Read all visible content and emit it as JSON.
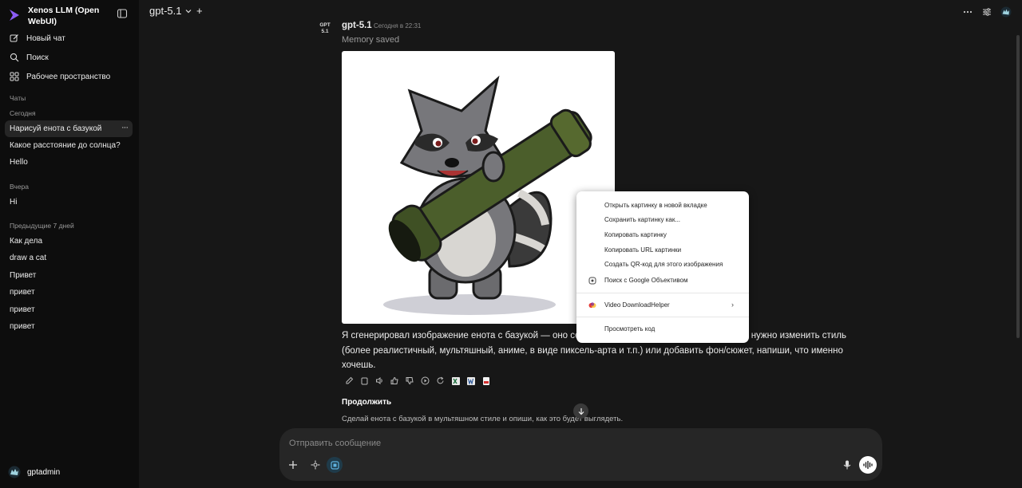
{
  "app": {
    "name": "Xenos LLM (Open WebUI)"
  },
  "sidebar": {
    "nav": [
      {
        "label": "Новый чат",
        "icon": "edit-icon"
      },
      {
        "label": "Поиск",
        "icon": "search-icon"
      },
      {
        "label": "Рабочее пространство",
        "icon": "workspace-icon"
      }
    ],
    "chats_label": "Чаты",
    "groups": [
      {
        "label": "Сегодня",
        "items": [
          "Нарисуй енота с базукой",
          "Какое расстояние до солнца?",
          "Hello"
        ]
      },
      {
        "label": "Вчера",
        "items": [
          "Hi"
        ]
      },
      {
        "label": "Предыдущие 7 дней",
        "items": [
          "Как дела",
          "draw a cat",
          "Привет",
          "привет",
          "привет",
          "привет"
        ]
      }
    ],
    "more_label": "···",
    "user": "gptadmin"
  },
  "topbar": {
    "model": "gpt-5.1",
    "plus": "+"
  },
  "message": {
    "avatar_text_1": "GPT",
    "avatar_text_2": "5.1",
    "model": "gpt-5.1",
    "time": "Сегодня в 22:31",
    "status": "Memory saved",
    "text": "Я сгенерировал изображение енота с базукой — оно сейчас должно отображаться выше. Если нужно изменить стиль (более реалистичный, мультяшный, аниме, в виде пиксель-арта и т.п.) или добавить фон/сюжет, напиши, что именно хочешь."
  },
  "followup": {
    "title": "Продолжить",
    "suggestion": "Сделай енота с базукой в мультяшном стиле и опиши, как это будет выглядеть."
  },
  "composer": {
    "placeholder": "Отправить сообщение"
  },
  "context_menu": {
    "items": [
      "Открыть картинку в новой вкладке",
      "Сохранить картинку как...",
      "Копировать картинку",
      "Копировать URL картинки",
      "Создать QR-код для этого изображения",
      "Поиск с Google Объективом",
      "Video DownloadHelper",
      "Просмотреть код"
    ]
  },
  "colors": {
    "background": "#171717",
    "sidebar": "#0d0d0d",
    "accent": "#7c3aed",
    "composer": "#262626"
  }
}
